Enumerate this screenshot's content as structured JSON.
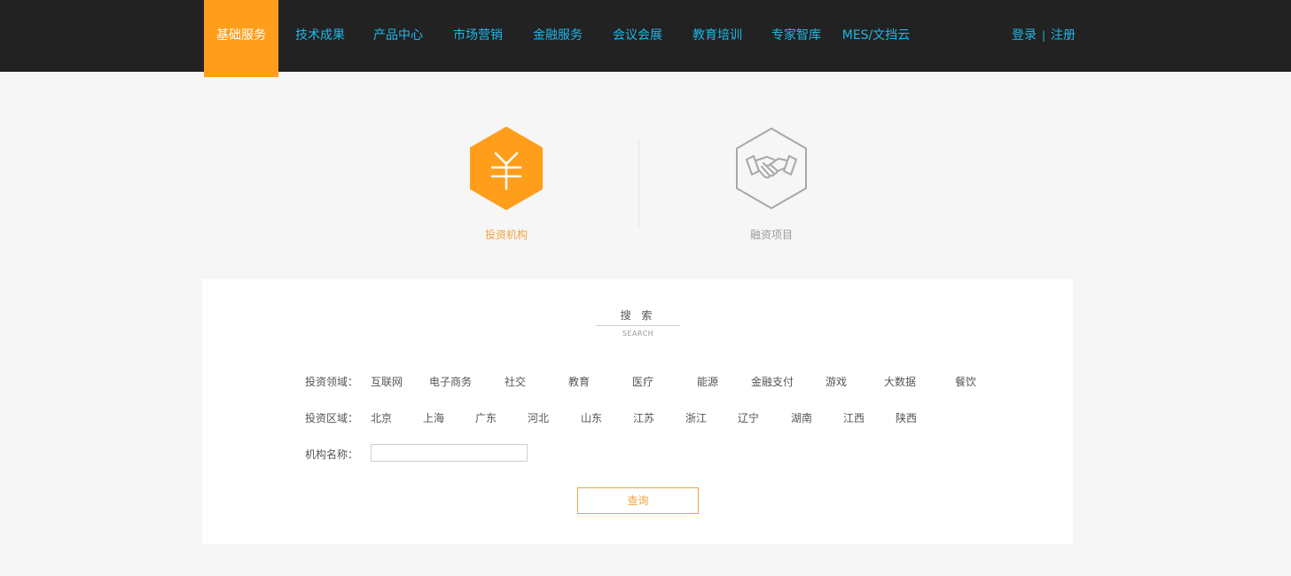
{
  "nav": {
    "items": [
      "基础服务",
      "技术成果",
      "产品中心",
      "市场营销",
      "金融服务",
      "会议会展",
      "教育培训",
      "专家智库",
      "MES/文挡云"
    ],
    "active_index": 0,
    "login": "登录",
    "register": "注册",
    "separator": "|"
  },
  "types": {
    "investor": {
      "label": "投资机构",
      "icon": "yuan-icon",
      "active": true
    },
    "project": {
      "label": "融资项目",
      "icon": "handshake-icon",
      "active": false
    }
  },
  "search": {
    "title": "搜 索",
    "subtitle": "SEARCH",
    "field_label": "投资领域：",
    "fields": [
      "互联网",
      "电子商务",
      "社交",
      "教育",
      "医疗",
      "能源",
      "金融支付",
      "游戏",
      "大数据",
      "餐饮"
    ],
    "region_label": "投资区域：",
    "regions": [
      "北京",
      "上海",
      "广东",
      "河北",
      "山东",
      "江苏",
      "浙江",
      "辽宁",
      "湖南",
      "江西",
      "陕西"
    ],
    "name_label": "机构名称：",
    "name_value": "",
    "query_button": "查询"
  },
  "colors": {
    "accent": "#ff9e1b",
    "nav_text": "#1fb6e8",
    "topbar_bg": "#222222",
    "inactive_icon": "#a8a8a8"
  }
}
